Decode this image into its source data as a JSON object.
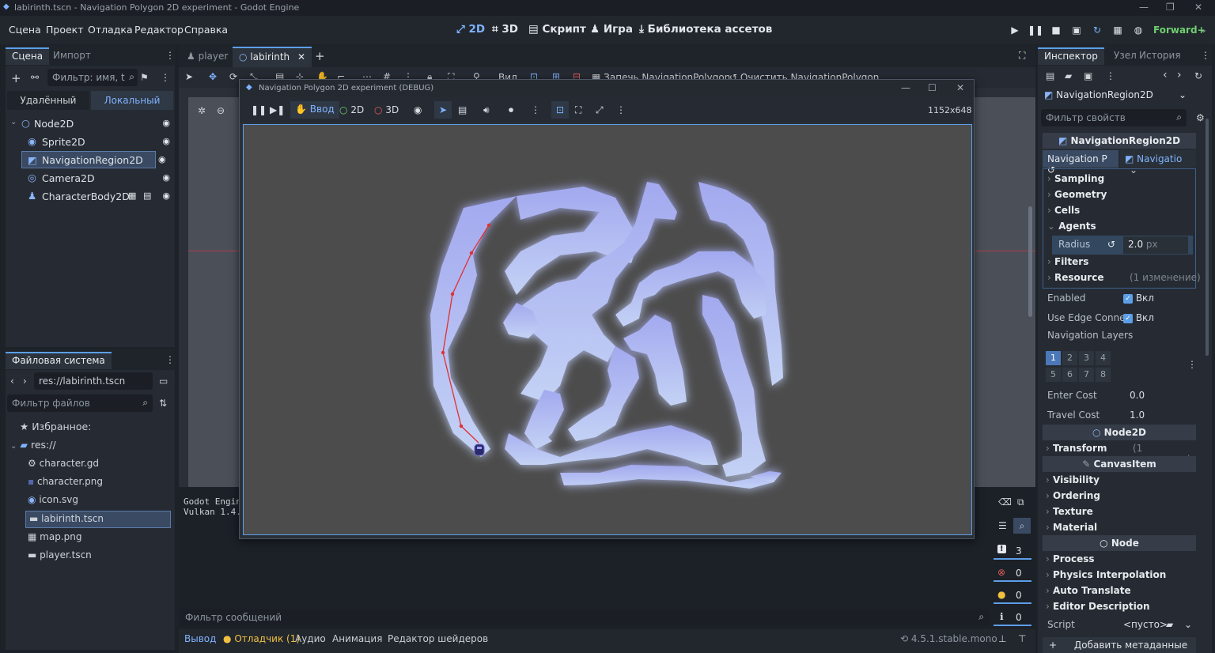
{
  "window": {
    "title": "labirinth.tscn - Navigation Polygon 2D experiment - Godot Engine"
  },
  "menu": [
    "Сцена",
    "Проект",
    "Отладка",
    "Редактор",
    "Справка"
  ],
  "main_modes": {
    "m2d": "2D",
    "m3d": "3D",
    "script": "Скрипт",
    "game": "Игра",
    "assets": "Библиотека ассетов"
  },
  "renderer": "Forward+",
  "scene_dock": {
    "tabs": [
      "Сцена",
      "Импорт"
    ],
    "filter_placeholder": "Фильтр: имя, t",
    "view_tabs": [
      "Удалённый",
      "Локальный"
    ],
    "nodes": [
      {
        "name": "Node2D",
        "icon": "○"
      },
      {
        "name": "Sprite2D",
        "icon": "◉"
      },
      {
        "name": "NavigationRegion2D",
        "icon": "◩"
      },
      {
        "name": "Camera2D",
        "icon": "◎"
      },
      {
        "name": "CharacterBody2D",
        "icon": "♟"
      }
    ]
  },
  "filesystem": {
    "title": "Файловая система",
    "path": "res://labirinth.tscn",
    "filter_placeholder": "Фильтр файлов",
    "favorites": "Избранное:",
    "root": "res://",
    "files": [
      {
        "name": "character.gd",
        "icon": "⚙"
      },
      {
        "name": "character.png",
        "icon": "▪"
      },
      {
        "name": "icon.svg",
        "icon": "◉"
      },
      {
        "name": "labirinth.tscn",
        "icon": "▬"
      },
      {
        "name": "map.png",
        "icon": "▦"
      },
      {
        "name": "player.tscn",
        "icon": "▬"
      }
    ]
  },
  "editor_tabs": {
    "tab1": "player",
    "tab2": "labirinth"
  },
  "canvas_toolbar": {
    "view": "Вид",
    "bake": "Запечь NavigationPolygon",
    "clear": "Очистить NavigationPolygon"
  },
  "debug_window": {
    "title": "Navigation Polygon 2D experiment (DEBUG)",
    "input": "Ввод",
    "mode2d": "2D",
    "mode3d": "3D",
    "resolution": "1152x648"
  },
  "output": {
    "line1": "Godot Engin",
    "line2": "Vulkan 1.4.",
    "filter_placeholder": "Фильтр сообщений",
    "counts": {
      "all": "3",
      "errors": "0",
      "warnings": "0",
      "info": "0"
    }
  },
  "bottom_tabs": {
    "output": "Вывод",
    "debugger": "Отладчик (1)",
    "audio": "Аудио",
    "animation": "Анимация",
    "shader": "Редактор шейдеров"
  },
  "version": "4.5.1.stable.mono",
  "inspector": {
    "tabs": [
      "Инспектор",
      "Узел",
      "История"
    ],
    "object": "NavigationRegion2D",
    "filter_placeholder": "Фильтр свойств",
    "class_header": "NavigationRegion2D",
    "resource_tab": "Navigation P",
    "resource_tab2": "Navigatio",
    "sub_sections": [
      "Sampling",
      "Geometry",
      "Cells",
      "Agents"
    ],
    "radius_label": "Radius",
    "radius_value": "2.0",
    "radius_unit": "px",
    "filters": "Filters",
    "resource": "Resource",
    "change1": "(1 изменение)",
    "enabled_label": "Enabled",
    "on": "Вкл",
    "edge_label": "Use Edge Conne",
    "layers_label": "Navigation Layers",
    "layers": [
      "1",
      "2",
      "3",
      "4",
      "5",
      "6",
      "7",
      "8"
    ],
    "enter_cost_label": "Enter Cost",
    "enter_cost": "0.0",
    "travel_cost_label": "Travel Cost",
    "travel_cost": "1.0",
    "node2d": "Node2D",
    "transform": "Transform",
    "canvasitem": "CanvasItem",
    "canvas_sections": [
      "Visibility",
      "Ordering",
      "Texture",
      "Material"
    ],
    "node": "Node",
    "node_sections": [
      "Process",
      "Physics Interpolation",
      "Auto Translate",
      "Editor Description"
    ],
    "script_label": "Script",
    "script_value": "<пусто>",
    "add_meta": "Добавить метаданные"
  }
}
